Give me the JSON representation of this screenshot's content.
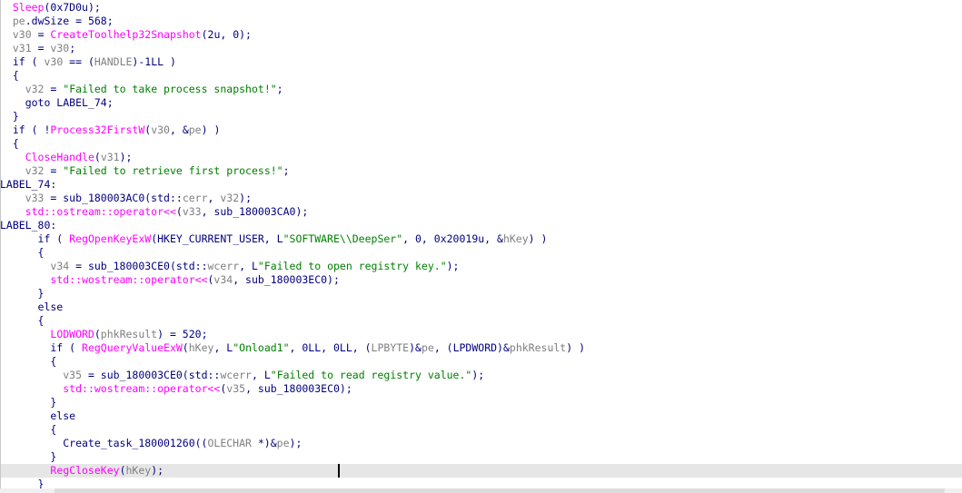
{
  "lines": [
    {
      "highlight": false,
      "tokens": [
        {
          "t": "  ",
          "c": "txt"
        },
        {
          "t": "Sleep",
          "c": "fn"
        },
        {
          "t": "(0x7D0u);",
          "c": "txt"
        }
      ]
    },
    {
      "highlight": false,
      "tokens": [
        {
          "t": "  ",
          "c": "txt"
        },
        {
          "t": "pe",
          "c": "var"
        },
        {
          "t": ".dwSize = 568;",
          "c": "txt"
        }
      ]
    },
    {
      "highlight": false,
      "tokens": [
        {
          "t": "  ",
          "c": "txt"
        },
        {
          "t": "v30",
          "c": "var"
        },
        {
          "t": " = ",
          "c": "txt"
        },
        {
          "t": "CreateToolhelp32Snapshot",
          "c": "fn"
        },
        {
          "t": "(2u, 0);",
          "c": "txt"
        }
      ]
    },
    {
      "highlight": false,
      "tokens": [
        {
          "t": "  ",
          "c": "txt"
        },
        {
          "t": "v31",
          "c": "var"
        },
        {
          "t": " = ",
          "c": "txt"
        },
        {
          "t": "v30",
          "c": "var"
        },
        {
          "t": ";",
          "c": "txt"
        }
      ]
    },
    {
      "highlight": false,
      "tokens": [
        {
          "t": "  if ( ",
          "c": "txt"
        },
        {
          "t": "v30",
          "c": "var"
        },
        {
          "t": " == (",
          "c": "txt"
        },
        {
          "t": "HANDLE",
          "c": "var"
        },
        {
          "t": ")-1LL )",
          "c": "txt"
        }
      ]
    },
    {
      "highlight": false,
      "tokens": [
        {
          "t": "  {",
          "c": "txt"
        }
      ]
    },
    {
      "highlight": false,
      "tokens": [
        {
          "t": "    ",
          "c": "txt"
        },
        {
          "t": "v32",
          "c": "var"
        },
        {
          "t": " = ",
          "c": "txt"
        },
        {
          "t": "\"Failed to take process snapshot!\"",
          "c": "str"
        },
        {
          "t": ";",
          "c": "txt"
        }
      ]
    },
    {
      "highlight": false,
      "tokens": [
        {
          "t": "    goto LABEL_74;",
          "c": "txt"
        }
      ]
    },
    {
      "highlight": false,
      "tokens": [
        {
          "t": "  }",
          "c": "txt"
        }
      ]
    },
    {
      "highlight": false,
      "tokens": [
        {
          "t": "  if ( !",
          "c": "txt"
        },
        {
          "t": "Process32FirstW",
          "c": "fn"
        },
        {
          "t": "(",
          "c": "txt"
        },
        {
          "t": "v30",
          "c": "var"
        },
        {
          "t": ", &",
          "c": "txt"
        },
        {
          "t": "pe",
          "c": "var"
        },
        {
          "t": ") )",
          "c": "txt"
        }
      ]
    },
    {
      "highlight": false,
      "tokens": [
        {
          "t": "  {",
          "c": "txt"
        }
      ]
    },
    {
      "highlight": false,
      "tokens": [
        {
          "t": "    ",
          "c": "txt"
        },
        {
          "t": "CloseHandle",
          "c": "fn"
        },
        {
          "t": "(",
          "c": "txt"
        },
        {
          "t": "v31",
          "c": "var"
        },
        {
          "t": ");",
          "c": "txt"
        }
      ]
    },
    {
      "highlight": false,
      "tokens": [
        {
          "t": "    ",
          "c": "txt"
        },
        {
          "t": "v32",
          "c": "var"
        },
        {
          "t": " = ",
          "c": "txt"
        },
        {
          "t": "\"Failed to retrieve first process!\"",
          "c": "str"
        },
        {
          "t": ";",
          "c": "txt"
        }
      ]
    },
    {
      "highlight": false,
      "tokens": [
        {
          "t": "LABEL_74:",
          "c": "txt"
        }
      ]
    },
    {
      "highlight": false,
      "tokens": [
        {
          "t": "    ",
          "c": "txt"
        },
        {
          "t": "v33",
          "c": "var"
        },
        {
          "t": " = sub_180003AC0(std::",
          "c": "txt"
        },
        {
          "t": "cerr",
          "c": "var"
        },
        {
          "t": ", ",
          "c": "txt"
        },
        {
          "t": "v32",
          "c": "var"
        },
        {
          "t": ");",
          "c": "txt"
        }
      ]
    },
    {
      "highlight": false,
      "tokens": [
        {
          "t": "    ",
          "c": "txt"
        },
        {
          "t": "std::ostream::operator<<",
          "c": "fn"
        },
        {
          "t": "(",
          "c": "txt"
        },
        {
          "t": "v33",
          "c": "var"
        },
        {
          "t": ", sub_180003CA0);",
          "c": "txt"
        }
      ]
    },
    {
      "highlight": false,
      "tokens": [
        {
          "t": "LABEL_80:",
          "c": "txt"
        }
      ]
    },
    {
      "highlight": false,
      "tokens": [
        {
          "t": "      if ( ",
          "c": "txt"
        },
        {
          "t": "RegOpenKeyExW",
          "c": "fn"
        },
        {
          "t": "(HKEY_CURRENT_USER, L",
          "c": "txt"
        },
        {
          "t": "\"SOFTWARE\\\\DeepSer\"",
          "c": "str"
        },
        {
          "t": ", 0, 0x20019u, &",
          "c": "txt"
        },
        {
          "t": "hKey",
          "c": "var"
        },
        {
          "t": ") )",
          "c": "txt"
        }
      ]
    },
    {
      "highlight": false,
      "tokens": [
        {
          "t": "      {",
          "c": "txt"
        }
      ]
    },
    {
      "highlight": false,
      "tokens": [
        {
          "t": "        ",
          "c": "txt"
        },
        {
          "t": "v34",
          "c": "var"
        },
        {
          "t": " = sub_180003CE0(std::",
          "c": "txt"
        },
        {
          "t": "wcerr",
          "c": "var"
        },
        {
          "t": ", L",
          "c": "txt"
        },
        {
          "t": "\"Failed to open registry key.\"",
          "c": "str"
        },
        {
          "t": ");",
          "c": "txt"
        }
      ]
    },
    {
      "highlight": false,
      "tokens": [
        {
          "t": "        ",
          "c": "txt"
        },
        {
          "t": "std::wostream::operator<<",
          "c": "fn"
        },
        {
          "t": "(",
          "c": "txt"
        },
        {
          "t": "v34",
          "c": "var"
        },
        {
          "t": ", sub_180003EC0);",
          "c": "txt"
        }
      ]
    },
    {
      "highlight": false,
      "tokens": [
        {
          "t": "      }",
          "c": "txt"
        }
      ]
    },
    {
      "highlight": false,
      "tokens": [
        {
          "t": "      else",
          "c": "txt"
        }
      ]
    },
    {
      "highlight": false,
      "tokens": [
        {
          "t": "      {",
          "c": "txt"
        }
      ]
    },
    {
      "highlight": false,
      "tokens": [
        {
          "t": "        ",
          "c": "txt"
        },
        {
          "t": "LODWORD",
          "c": "fn"
        },
        {
          "t": "(",
          "c": "txt"
        },
        {
          "t": "phkResult",
          "c": "var"
        },
        {
          "t": ") = 520;",
          "c": "txt"
        }
      ]
    },
    {
      "highlight": false,
      "tokens": [
        {
          "t": "        if ( ",
          "c": "txt"
        },
        {
          "t": "RegQueryValueExW",
          "c": "fn"
        },
        {
          "t": "(",
          "c": "txt"
        },
        {
          "t": "hKey",
          "c": "var"
        },
        {
          "t": ", L",
          "c": "txt"
        },
        {
          "t": "\"Onload1\"",
          "c": "str"
        },
        {
          "t": ", 0LL, 0LL, (",
          "c": "txt"
        },
        {
          "t": "LPBYTE",
          "c": "var"
        },
        {
          "t": ")&",
          "c": "txt"
        },
        {
          "t": "pe",
          "c": "var"
        },
        {
          "t": ", (LPDWORD)&",
          "c": "txt"
        },
        {
          "t": "phkResult",
          "c": "var"
        },
        {
          "t": ") )",
          "c": "txt"
        }
      ]
    },
    {
      "highlight": false,
      "tokens": [
        {
          "t": "        {",
          "c": "txt"
        }
      ]
    },
    {
      "highlight": false,
      "tokens": [
        {
          "t": "          ",
          "c": "txt"
        },
        {
          "t": "v35",
          "c": "var"
        },
        {
          "t": " = sub_180003CE0(std::",
          "c": "txt"
        },
        {
          "t": "wcerr",
          "c": "var"
        },
        {
          "t": ", L",
          "c": "txt"
        },
        {
          "t": "\"Failed to read registry value.\"",
          "c": "str"
        },
        {
          "t": ");",
          "c": "txt"
        }
      ]
    },
    {
      "highlight": false,
      "tokens": [
        {
          "t": "          ",
          "c": "txt"
        },
        {
          "t": "std::wostream::operator<<",
          "c": "fn"
        },
        {
          "t": "(",
          "c": "txt"
        },
        {
          "t": "v35",
          "c": "var"
        },
        {
          "t": ", sub_180003EC0);",
          "c": "txt"
        }
      ]
    },
    {
      "highlight": false,
      "tokens": [
        {
          "t": "        }",
          "c": "txt"
        }
      ]
    },
    {
      "highlight": false,
      "tokens": [
        {
          "t": "        else",
          "c": "txt"
        }
      ]
    },
    {
      "highlight": false,
      "tokens": [
        {
          "t": "        {",
          "c": "txt"
        }
      ]
    },
    {
      "highlight": false,
      "tokens": [
        {
          "t": "          Create_task_180001260((",
          "c": "txt"
        },
        {
          "t": "OLECHAR",
          "c": "var"
        },
        {
          "t": " *)&",
          "c": "txt"
        },
        {
          "t": "pe",
          "c": "var"
        },
        {
          "t": ");",
          "c": "txt"
        }
      ]
    },
    {
      "highlight": false,
      "tokens": [
        {
          "t": "        }",
          "c": "txt"
        }
      ]
    },
    {
      "highlight": true,
      "tokens": [
        {
          "t": "        ",
          "c": "txt"
        },
        {
          "t": "RegCloseKey",
          "c": "fn"
        },
        {
          "t": "(",
          "c": "txt"
        },
        {
          "t": "hKey",
          "c": "var"
        },
        {
          "t": ");",
          "c": "txt"
        }
      ]
    },
    {
      "highlight": false,
      "tokens": [
        {
          "t": "      }",
          "c": "txt"
        }
      ]
    }
  ]
}
